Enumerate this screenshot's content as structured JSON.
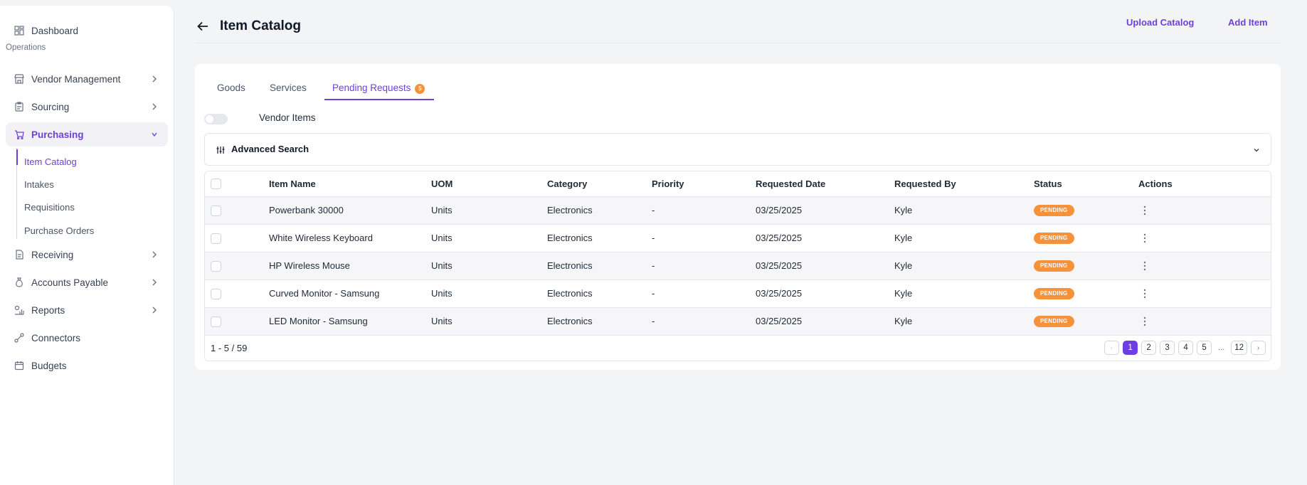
{
  "sidebar": {
    "items": [
      {
        "label": "Dashboard",
        "icon": "grid-icon"
      },
      {
        "label": "Vendor Management",
        "icon": "store-icon"
      },
      {
        "label": "Sourcing",
        "icon": "clipboard-icon"
      },
      {
        "label": "Purchasing",
        "icon": "cart-icon"
      },
      {
        "label": "Receiving",
        "icon": "document-icon"
      },
      {
        "label": "Accounts Payable",
        "icon": "moneybag-icon"
      },
      {
        "label": "Reports",
        "icon": "report-chart-icon"
      },
      {
        "label": "Connectors",
        "icon": "connector-icon"
      },
      {
        "label": "Budgets",
        "icon": "calendar-icon"
      }
    ],
    "section_label": "Operations",
    "purchasing_sub": [
      "Item Catalog",
      "Intakes",
      "Requisitions",
      "Purchase Orders"
    ]
  },
  "header": {
    "title": "Item Catalog",
    "upload_label": "Upload Catalog",
    "add_label": "Add Item"
  },
  "tabs": [
    {
      "label": "Goods"
    },
    {
      "label": "Services"
    },
    {
      "label": "Pending Requests",
      "badge": "5"
    }
  ],
  "toggle": {
    "label": "Vendor Items",
    "on": false
  },
  "advanced_search": {
    "label": "Advanced Search"
  },
  "table": {
    "columns": [
      "Item Name",
      "UOM",
      "Category",
      "Priority",
      "Requested Date",
      "Requested By",
      "Status",
      "Actions"
    ],
    "rows": [
      {
        "name": "Powerbank 30000",
        "uom": "Units",
        "category": "Electronics",
        "priority": "-",
        "date": "03/25/2025",
        "by": "Kyle",
        "status": "PENDING"
      },
      {
        "name": "White Wireless Keyboard",
        "uom": "Units",
        "category": "Electronics",
        "priority": "-",
        "date": "03/25/2025",
        "by": "Kyle",
        "status": "PENDING"
      },
      {
        "name": "HP Wireless Mouse",
        "uom": "Units",
        "category": "Electronics",
        "priority": "-",
        "date": "03/25/2025",
        "by": "Kyle",
        "status": "PENDING"
      },
      {
        "name": "Curved Monitor - Samsung",
        "uom": "Units",
        "category": "Electronics",
        "priority": "-",
        "date": "03/25/2025",
        "by": "Kyle",
        "status": "PENDING"
      },
      {
        "name": "LED Monitor - Samsung",
        "uom": "Units",
        "category": "Electronics",
        "priority": "-",
        "date": "03/25/2025",
        "by": "Kyle",
        "status": "PENDING"
      }
    ]
  },
  "pagination": {
    "range": "1 - 5 / 59",
    "pages": [
      "1",
      "2",
      "3",
      "4",
      "5"
    ],
    "ellipsis": "...",
    "last": "12",
    "current": "1"
  },
  "colors": {
    "accent": "#6d3fe0",
    "pending": "#f7923a"
  }
}
